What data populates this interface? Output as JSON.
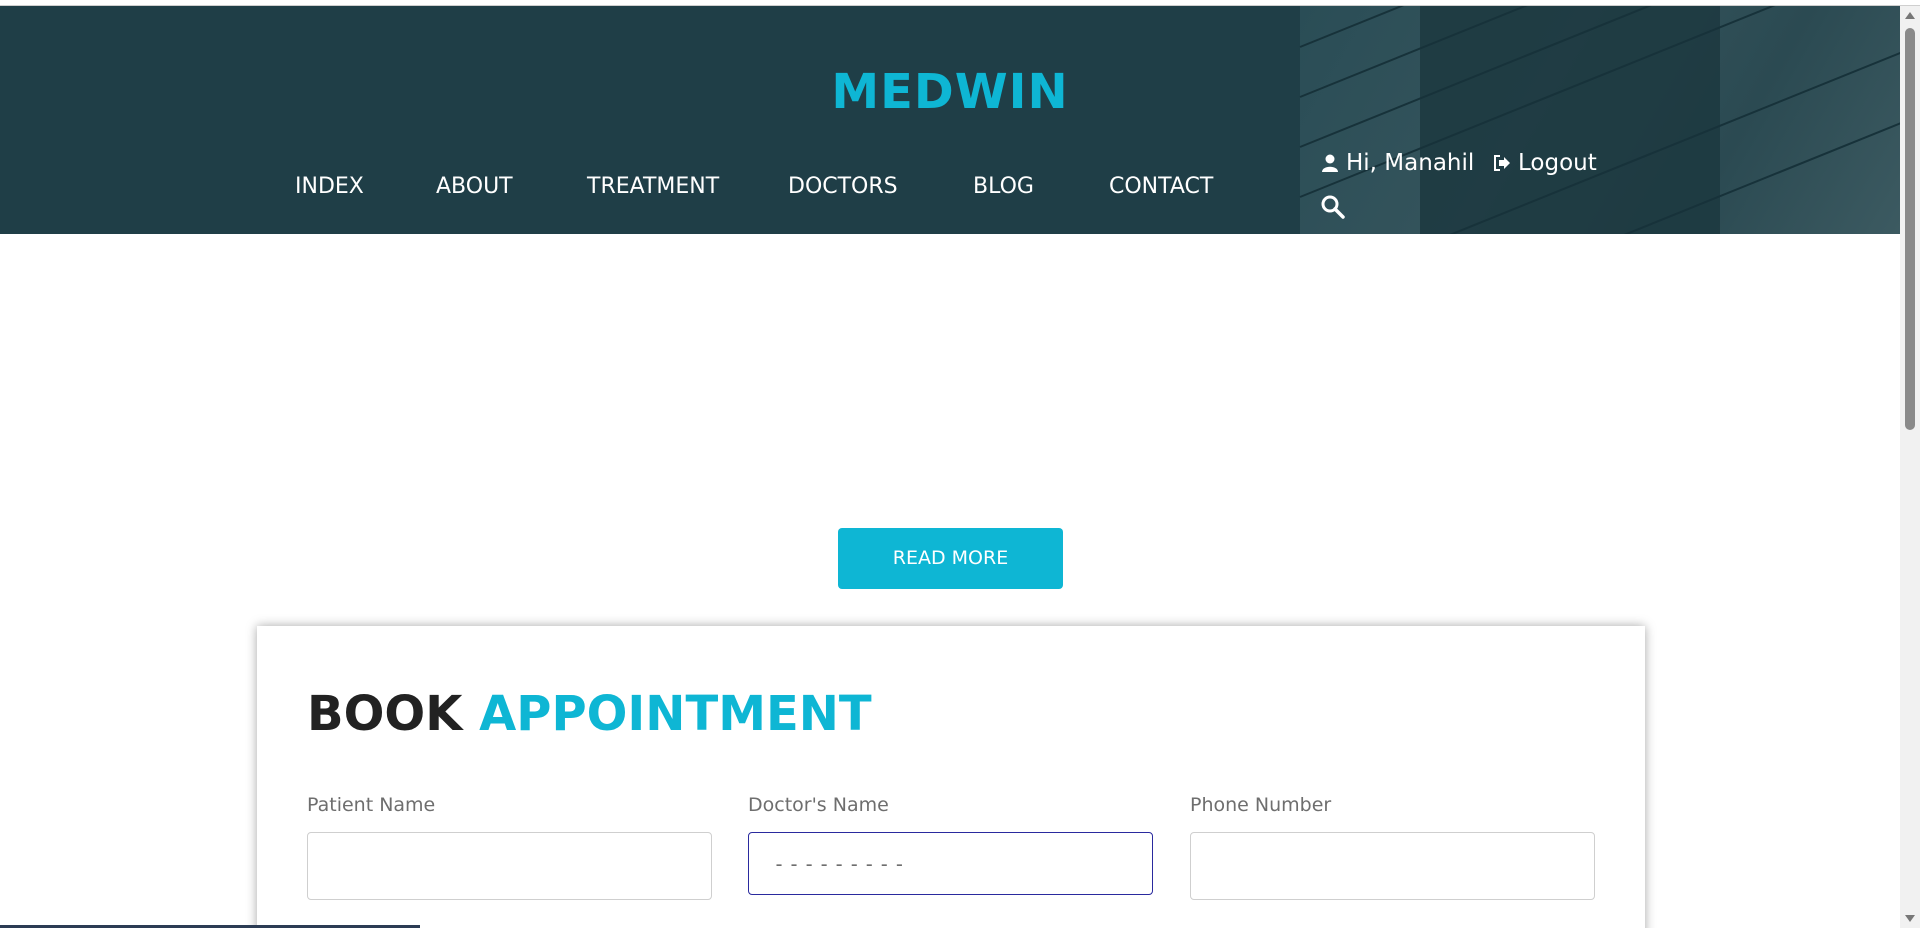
{
  "brand": {
    "name": "MEDWIN"
  },
  "nav": {
    "items": [
      {
        "label": "INDEX"
      },
      {
        "label": "ABOUT"
      },
      {
        "label": "TREATMENT"
      },
      {
        "label": "DOCTORS"
      },
      {
        "label": "BLOG"
      },
      {
        "label": "CONTACT"
      }
    ]
  },
  "user": {
    "greeting": "Hi, Manahil",
    "logout_label": "Logout"
  },
  "hero": {
    "read_more_label": "READ MORE"
  },
  "appointment": {
    "title_dark": "BOOK",
    "title_accent": "APPOINTMENT",
    "fields": [
      {
        "label": "Patient Name",
        "value": "",
        "placeholder": ""
      },
      {
        "label": "Doctor's Name",
        "value": "",
        "placeholder": "---------"
      },
      {
        "label": "Phone Number",
        "value": "",
        "placeholder": ""
      }
    ]
  },
  "colors": {
    "header_bg": "#1f3e47",
    "accent": "#0eb6d4",
    "heading_dark": "#222222",
    "focus_border": "#2a2a9e"
  },
  "icons": [
    "user-icon",
    "logout-icon",
    "search-icon"
  ]
}
